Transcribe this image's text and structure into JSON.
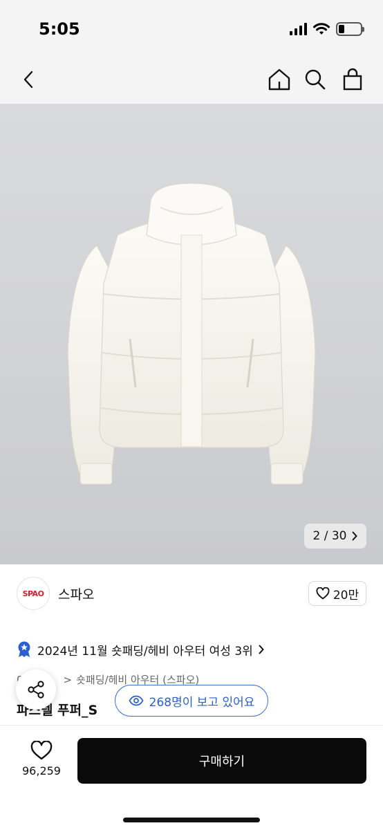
{
  "status_bar": {
    "time": "5:05",
    "battery_level": 0.25
  },
  "nav": {
    "icons": [
      "back-icon",
      "home-icon",
      "search-icon",
      "shopping-bag-icon"
    ]
  },
  "gallery": {
    "counter": "2 / 30"
  },
  "brand": {
    "logo_text": "SPAO",
    "name": "스파오",
    "like_count": "20만"
  },
  "ranking": {
    "text": "2024년 11월 숏패딩/헤비 아우터 여성 3위"
  },
  "breadcrumb": {
    "prefix": "0",
    "separator": ">",
    "category": "숏패딩/헤비 아우터 (스파오)"
  },
  "product": {
    "title": "파스텔 푸퍼_S"
  },
  "viewers": {
    "text": "268명이 보고 있어요"
  },
  "bottom": {
    "wish_count": "96,259",
    "buy_label": "구매하기"
  },
  "colors": {
    "accent_blue": "#2a5fd0",
    "buy_button": "#0b0b0b",
    "brand_red": "#d4202c"
  }
}
